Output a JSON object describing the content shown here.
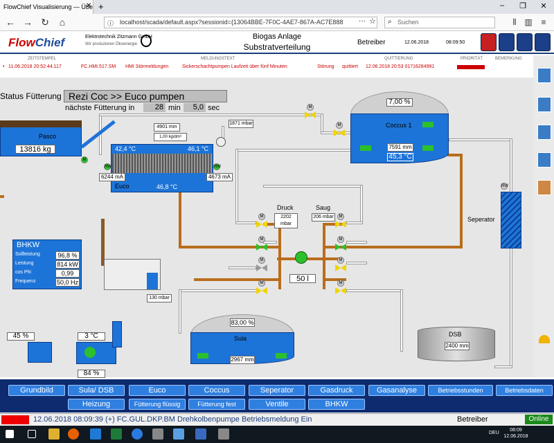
{
  "browser": {
    "tab_title": "FlowChief Visualisierung — Übersic",
    "url": "localhost/scada/default.aspx?sessionid={13064BBE-7F0C-4AE7-867A-AC7E888",
    "search_placeholder": "Suchen"
  },
  "header": {
    "logo_flow": "Flow",
    "logo_chief": "Chief",
    "company": "Elektrotechnik Zitzmann GmbH",
    "company_sub": "Wir produzieren Ökoenergie",
    "title_line1": "Biogas Anlage",
    "title_line2": "Substratverteilung",
    "role": "Betreiber",
    "date": "12.06.2018",
    "time": "08:09:50"
  },
  "alarms": {
    "columns": [
      "ZEITSTEMPEL",
      "MELDUNGSTEXT",
      "QUITTIERUNG",
      "PRIORITÄT",
      "BEMERKUNG"
    ],
    "row": {
      "timestamp": "11.06.2018 20:52:44.117",
      "source": "FC.HMI.517.SM",
      "group": "HMI Störmeldungen",
      "text": "Sickerschachtpumpen Laufzeit über fünf Minuten",
      "type": "Störung",
      "state": "quittiert",
      "ack": "12.06.2018 20:53 01716284991"
    }
  },
  "feeding": {
    "status_label": "Status Fütterung",
    "status_value": "Rezi Coc >> Euco pumpen",
    "next_label": "nächste Fütterung in",
    "minutes": "28",
    "min_unit": "min",
    "seconds": "5,0",
    "sec_unit": "sec"
  },
  "pasco": {
    "label": "Pasco",
    "weight": "13816 kg"
  },
  "euco": {
    "label": "Euco",
    "temp_left": "42,4 °C",
    "temp_right": "46,1 °C",
    "temp_bottom": "46,8 °C",
    "current_left": "6244 mA",
    "current_right": "4673 mA",
    "level": "4901 mm",
    "density": "1,00 kg/dm³",
    "rw_left": "RW",
    "rw_right": "RW"
  },
  "coccus": {
    "label": "Coccus 1",
    "dome_pct": "7,00 %",
    "level": "7591 mm",
    "temp": "45,3 °C",
    "pressure": "1871 mbar"
  },
  "pump": {
    "druck_label": "Druck",
    "saug_label": "Saug",
    "druck_val": "2202 mbar",
    "saug_val": "206 mbar",
    "flow": "50 l"
  },
  "separator": {
    "label": "Seperator",
    "rw": "RW"
  },
  "bhkw": {
    "title": "BHKW",
    "rows": [
      {
        "label": "Sollleistung",
        "value": "96,8 %"
      },
      {
        "label": "Leistung",
        "value": "814 kW"
      },
      {
        "label": "cos Phi",
        "value": "0,99"
      },
      {
        "label": "Frequenz",
        "value": "50,0 Hz"
      }
    ],
    "pressure": "130 mbar"
  },
  "sula": {
    "label": "Sula",
    "dome_pct": "83,00 %",
    "level": "2967 mm"
  },
  "dsb": {
    "label": "DSB",
    "level": "2400 mm"
  },
  "misc": {
    "pct45": "45 %",
    "temp3": "3 °C",
    "pct84": "84 %"
  },
  "nav": {
    "row1": [
      "Grundbild",
      "Sula/ DSB",
      "Euco",
      "Coccus",
      "Seperator",
      "Gasdruck",
      "Gasanalyse",
      "Betriebsstunden",
      "Betriebsdaten"
    ],
    "row2": [
      "Heizung",
      "Fütterung flüssig",
      "Fütterung fest",
      "Ventile",
      "BHKW"
    ]
  },
  "status": {
    "message": "12.06.2018 08:09:39 (+) FC.GUL.DKP.BM Drehkolbenpumpe Betriebsmeldung Ein",
    "role": "Betreiber",
    "online": "Online"
  },
  "taskbar": {
    "lang": "DEU",
    "time": "08:09",
    "date": "12.06.2018"
  },
  "colors": {
    "tank_blue": "#1d74d8",
    "pipe_brown": "#b86d1c",
    "nav_blue": "#2f7fe0",
    "alarm_red": "#cc0000",
    "online_green": "#1a8a1a"
  }
}
